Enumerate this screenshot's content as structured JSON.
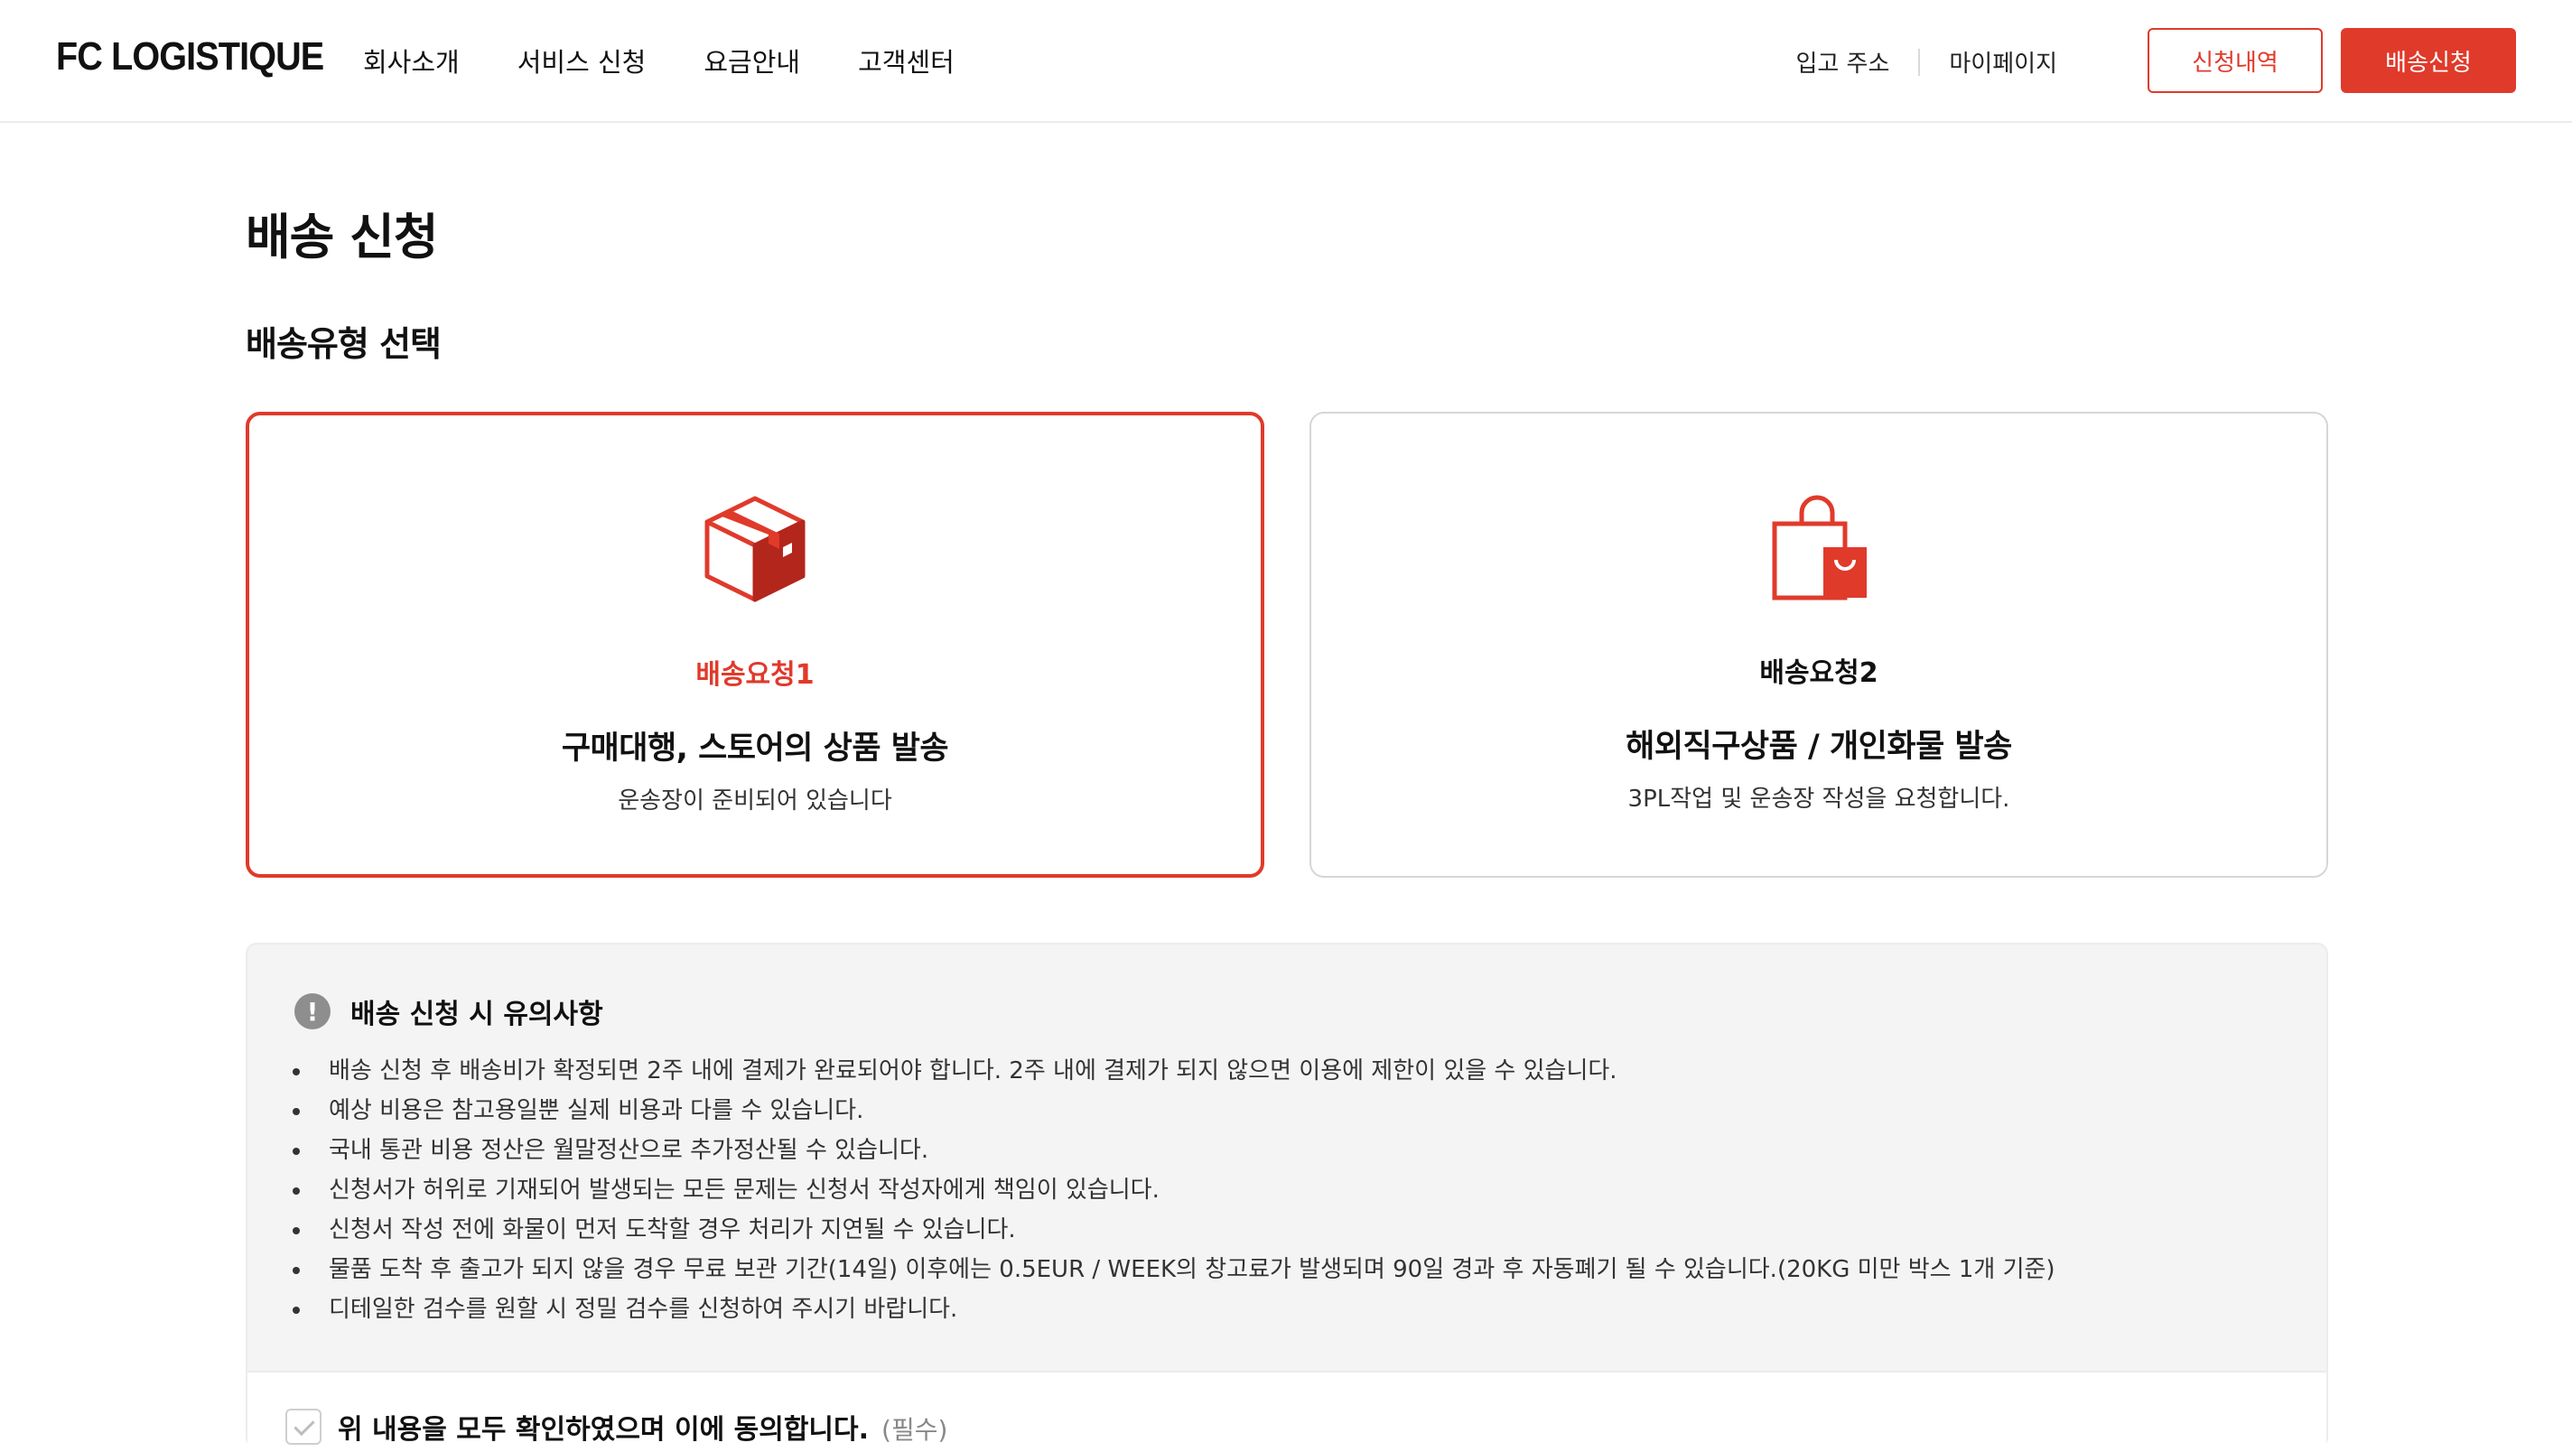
{
  "header": {
    "logo": "FC LOGISTIQUE",
    "nav": [
      "회사소개",
      "서비스 신청",
      "요금안내",
      "고객센터"
    ],
    "util_links": [
      "입고 주소",
      "마이페이지"
    ],
    "history_button": "신청내역",
    "apply_button": "배송신청"
  },
  "page": {
    "title": "배송 신청",
    "section_title": "배송유형 선택"
  },
  "cards": [
    {
      "icon": "box-icon",
      "label": "배송요청1",
      "heading": "구매대행, 스토어의 상품 발송",
      "desc": "운송장이 준비되어 있습니다",
      "selected": true
    },
    {
      "icon": "shopping-bag-icon",
      "label": "배송요청2",
      "heading": "해외직구상품 / 개인화물 발송",
      "desc": "3PL작업 및 운송장 작성을 요청합니다.",
      "selected": false
    }
  ],
  "notice": {
    "title": "배송 신청 시 유의사항",
    "items": [
      "배송 신청 후 배송비가 확정되면 2주 내에 결제가 완료되어야 합니다. 2주 내에 결제가 되지 않으면 이용에 제한이 있을 수 있습니다.",
      "예상 비용은 참고용일뿐 실제 비용과 다를 수 있습니다.",
      "국내 통관 비용 정산은 월말정산으로 추가정산될 수 있습니다.",
      "신청서가 허위로 기재되어 발생되는 모든 문제는 신청서 작성자에게 책임이 있습니다.",
      "신청서 작성 전에 화물이 먼저 도착할 경우 처리가 지연될 수 있습니다.",
      "물품 도착 후 출고가 되지 않을 경우 무료 보관 기간(14일) 이후에는 0.5EUR / WEEK의 창고료가 발생되며 90일 경과 후 자동폐기 될 수 있습니다.(20KG 미만 박스 1개 기준)",
      "디테일한 검수를 원할 시 정밀 검수를 신청하여 주시기 바랍니다."
    ],
    "agree_text": "위 내용을 모두 확인하였으며 이에 동의합니다.",
    "agree_required": "(필수)"
  },
  "colors": {
    "accent": "#e03a2b",
    "accent_dark": "#b3261c",
    "notice_bg": "#f4f4f4"
  }
}
